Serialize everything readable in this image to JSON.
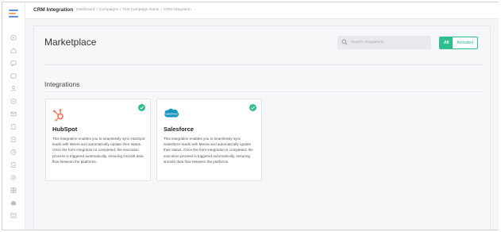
{
  "topbar": {
    "app_title": "CRM Integration",
    "breadcrumbs": [
      "Dashboard",
      "Campaigns",
      "Test Campaign Name",
      "CRM Integration"
    ],
    "separator": "/"
  },
  "sidebar": {
    "icons": [
      "dashboard-icon",
      "home-icon",
      "chat-icon",
      "message-icon",
      "users-icon",
      "inbox-icon",
      "mail-icon",
      "document-icon",
      "file-icon",
      "report-icon",
      "settings-icon",
      "page-icon",
      "gear-icon",
      "grid-icon",
      "storage-icon",
      "list-icon"
    ]
  },
  "main": {
    "title": "Marketplace",
    "search": {
      "placeholder": "Search integrations",
      "value": ""
    },
    "filter": {
      "all_label": "All",
      "activated_label": "Activated",
      "selected": "All"
    },
    "section_title": "Integrations",
    "integrations": [
      {
        "name": "HubSpot",
        "icon": "hubspot-icon",
        "activated": true,
        "description": "This integration enables you to seamlessly sync HubSpot leads with Meera and automatically update their status. Once the form integration is completed, the execution process is triggered automatically, ensuring smooth data flow between the platforms."
      },
      {
        "name": "Salesforce",
        "icon": "salesforce-icon",
        "activated": true,
        "description": "This integration enables you to seamlessly sync Salesforce leads with Meera and automatically update their status. Once the form integration is completed, the execution process is triggered automatically, ensuring smooth data flow between the platforms."
      }
    ]
  },
  "colors": {
    "accent": "#2fbf8f",
    "hubspot": "#ff7a59",
    "salesforce": "#1798c1"
  }
}
